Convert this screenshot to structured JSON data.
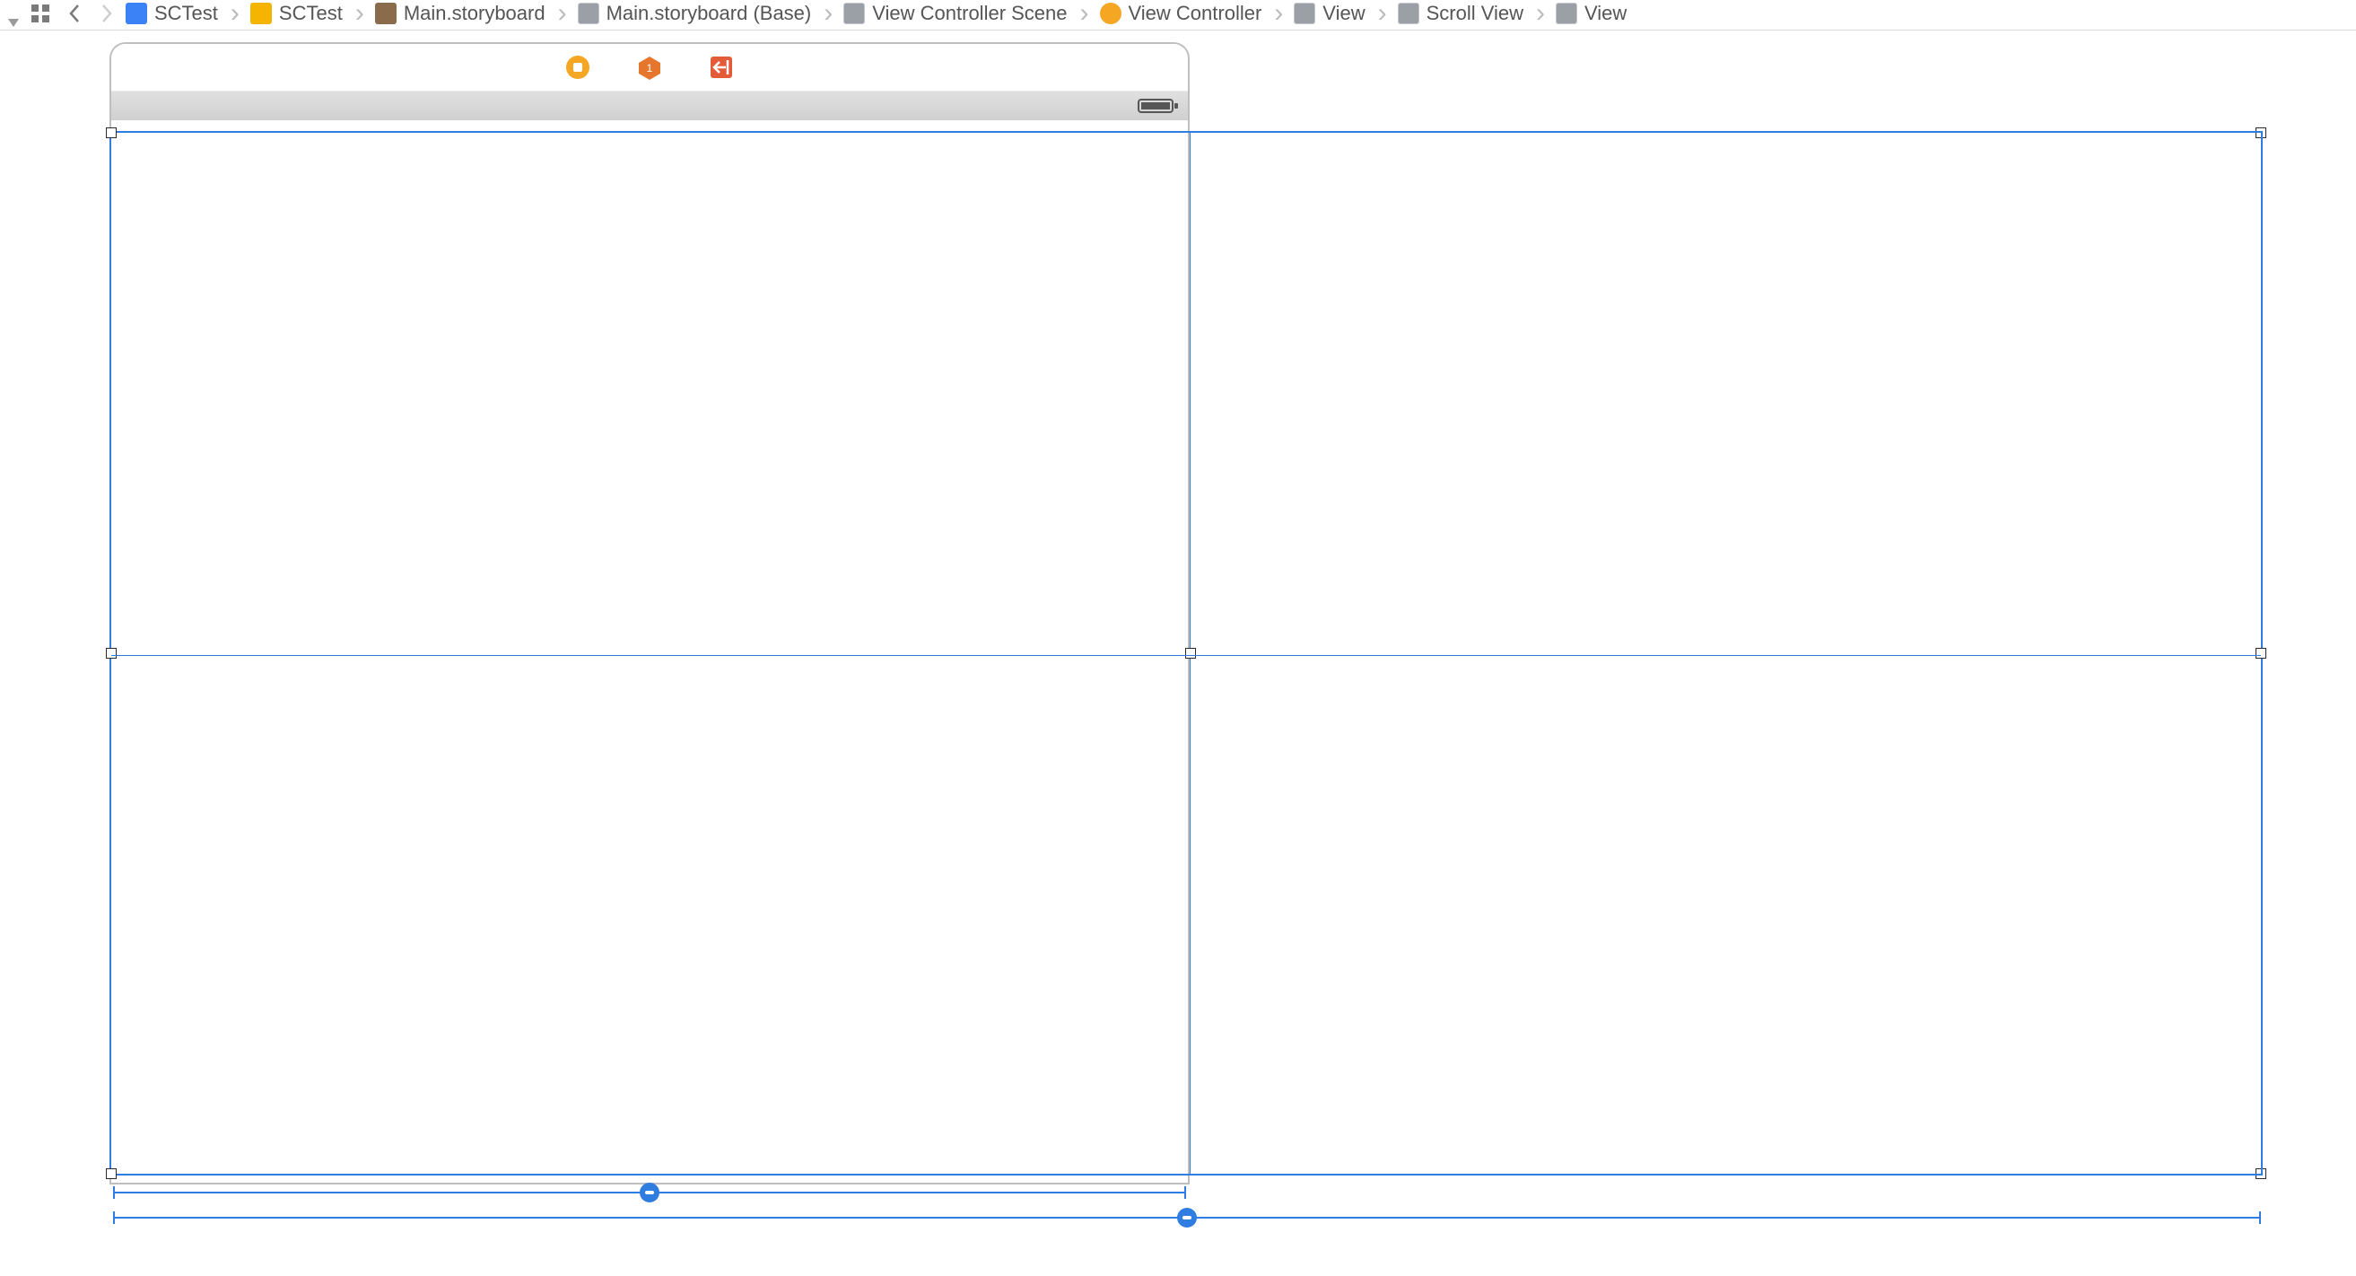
{
  "breadcrumbs": [
    {
      "icon": "blue",
      "label": "SCTest"
    },
    {
      "icon": "yellow",
      "label": "SCTest"
    },
    {
      "icon": "brown",
      "label": "Main.storyboard"
    },
    {
      "icon": "grey",
      "label": "Main.storyboard (Base)"
    },
    {
      "icon": "grey",
      "label": "View Controller Scene"
    },
    {
      "icon": "orange",
      "label": "View Controller"
    },
    {
      "icon": "grey",
      "label": "View"
    },
    {
      "icon": "grey",
      "label": "Scroll View"
    },
    {
      "icon": "grey",
      "label": "View"
    }
  ],
  "colors": {
    "selection": "#2f7de1",
    "device_border": "#bfbfbf",
    "status_strip": "#d6d6d6"
  }
}
